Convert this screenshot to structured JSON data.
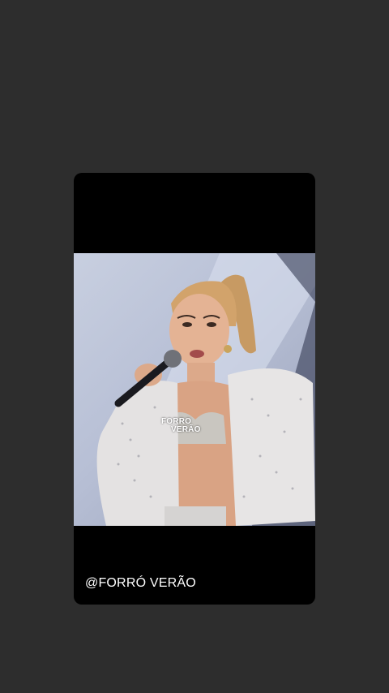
{
  "story": {
    "caption": "@FORRÓ VERÃO",
    "logo_line1": "FORRO",
    "logo_line2": "VERÃO"
  },
  "colors": {
    "page_background": "#2d2d2d",
    "card_background": "#000000",
    "caption_text": "#ffffff"
  }
}
